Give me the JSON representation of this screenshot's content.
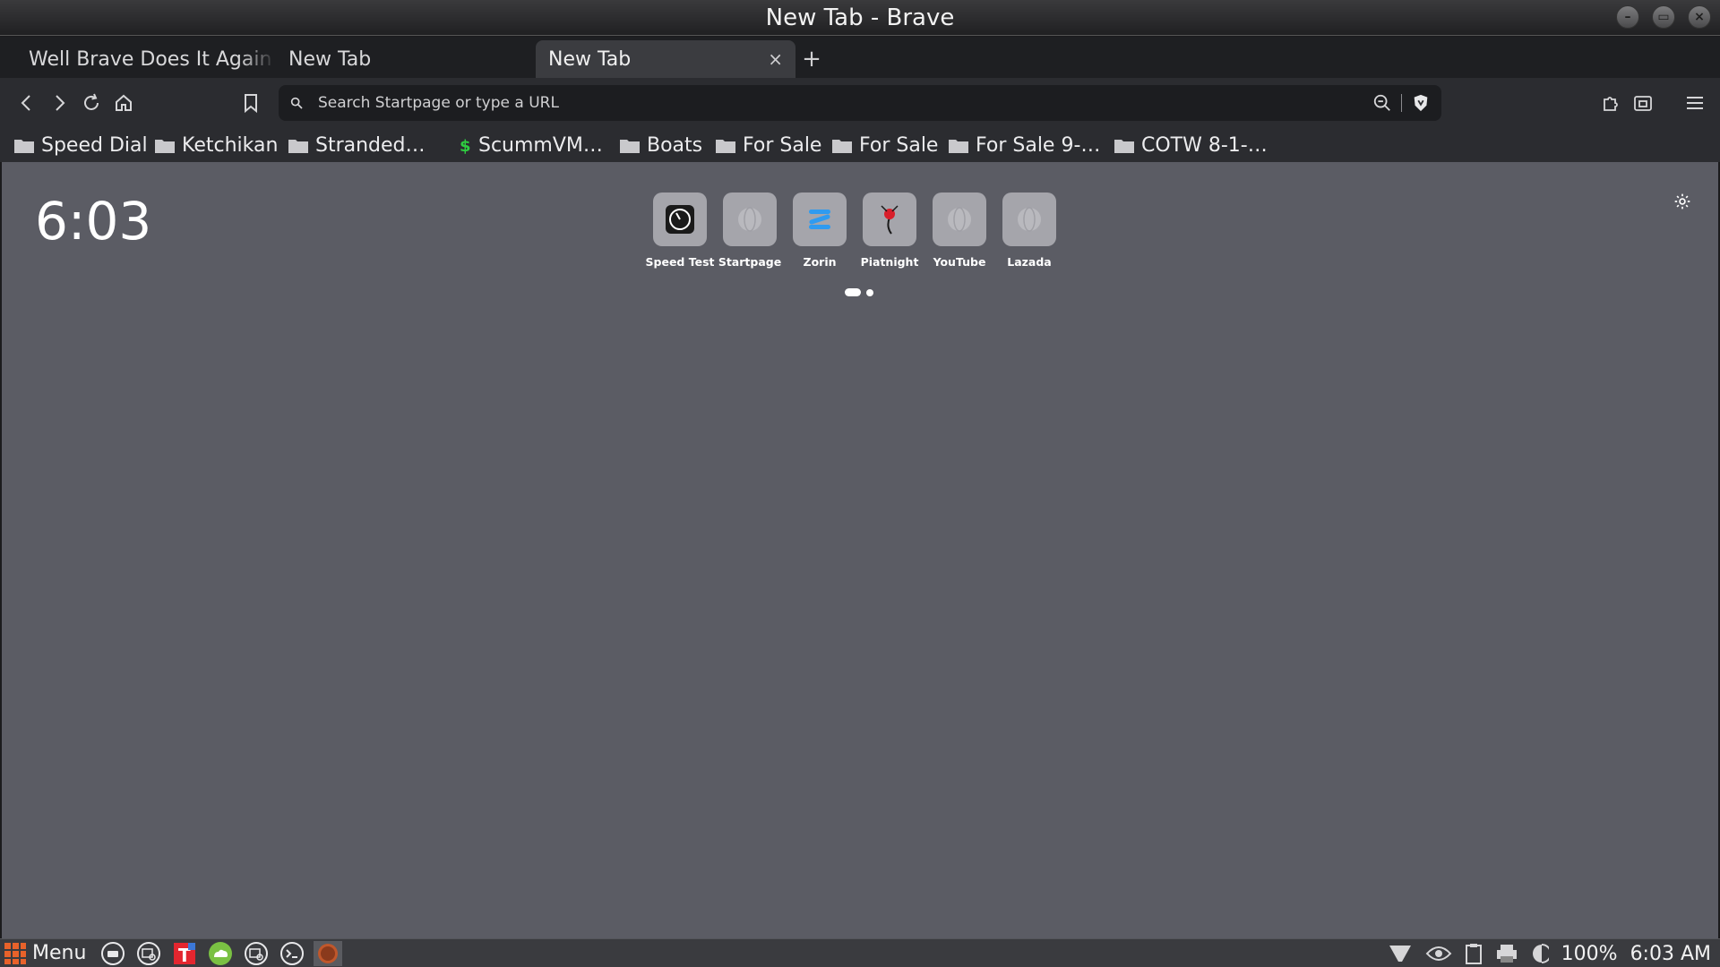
{
  "window": {
    "title": "New Tab - Brave"
  },
  "tabs": [
    {
      "label": "Well Brave Does It Again",
      "active": false
    },
    {
      "label": "New Tab",
      "active": false
    },
    {
      "label": "New Tab",
      "active": true
    }
  ],
  "tab_close_glyph": "×",
  "new_tab_glyph": "+",
  "urlbar": {
    "placeholder": "Search Startpage or type a URL"
  },
  "bookmarks": [
    {
      "label": "Speed Dial",
      "icon": "folder-icon"
    },
    {
      "label": "Ketchikan",
      "icon": "folder-icon"
    },
    {
      "label": "Stranded…",
      "icon": "folder-icon"
    },
    {
      "label": "ScummVM…",
      "icon": "dollar-icon"
    },
    {
      "label": "Boats",
      "icon": "folder-icon"
    },
    {
      "label": "For Sale",
      "icon": "folder-icon"
    },
    {
      "label": "For Sale",
      "icon": "folder-icon"
    },
    {
      "label": "For Sale 9-…",
      "icon": "folder-icon"
    },
    {
      "label": "COTW 8-1-…",
      "icon": "folder-icon"
    }
  ],
  "newtab": {
    "clock": "6:03",
    "top_sites": [
      {
        "label": "Speed Test",
        "icon": "speedometer-icon"
      },
      {
        "label": "Startpage",
        "icon": "globe-icon"
      },
      {
        "label": "Zorin",
        "icon": "zorin-icon"
      },
      {
        "label": "Piatnight",
        "icon": "joystick-icon"
      },
      {
        "label": "YouTube",
        "icon": "globe-icon"
      },
      {
        "label": "Lazada",
        "icon": "globe-icon"
      }
    ]
  },
  "taskbar": {
    "menu_label": "Menu",
    "battery": "100%",
    "time": "6:03 AM"
  },
  "colors": {
    "content_bg": "#5b5c64",
    "tile_bg": "#a5a5ab",
    "toolbar_bg": "#2b2c30",
    "accent_blue": "#2f9bf0"
  }
}
